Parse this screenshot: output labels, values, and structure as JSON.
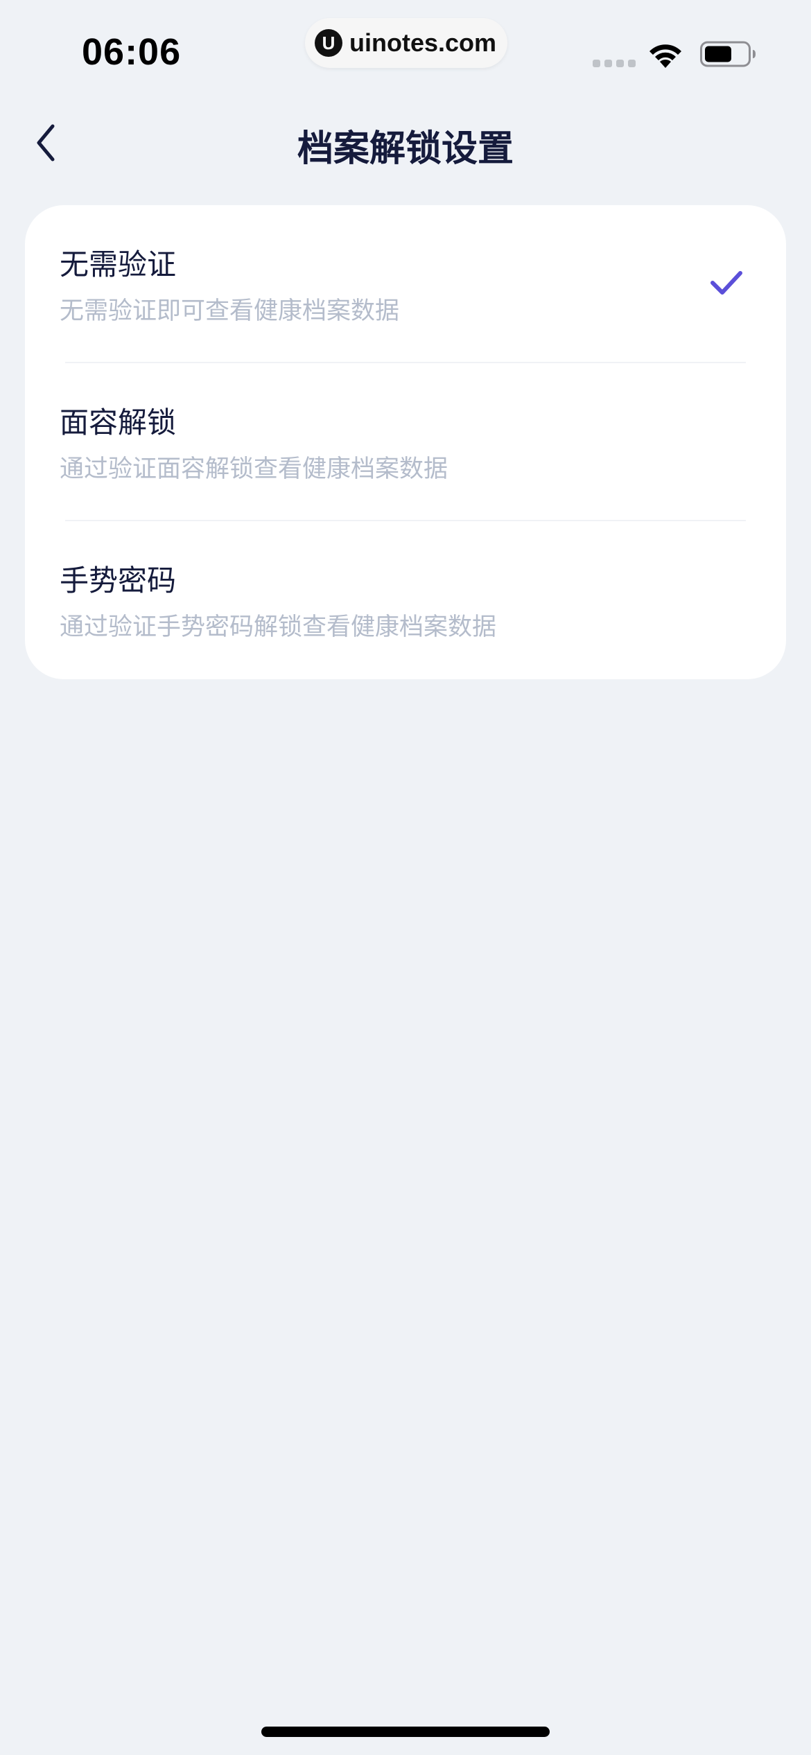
{
  "status_bar": {
    "time": "06:06",
    "watermark": "uinotes.com",
    "watermark_logo": "U",
    "icons": [
      "signal-dots-icon",
      "wifi-icon",
      "battery-icon"
    ]
  },
  "nav": {
    "title": "档案解锁设置",
    "back_icon": "chevron-left-icon"
  },
  "options": [
    {
      "title": "无需验证",
      "desc": "无需验证即可查看健康档案数据",
      "selected": true
    },
    {
      "title": "面容解锁",
      "desc": "通过验证面容解锁查看健康档案数据",
      "selected": false
    },
    {
      "title": "手势密码",
      "desc": "通过验证手势密码解锁查看健康档案数据",
      "selected": false
    }
  ],
  "colors": {
    "background": "#eff2f6",
    "card": "#ffffff",
    "title_text": "#151b3c",
    "desc_text": "#b4bccb",
    "accent": "#5b4fd9"
  }
}
